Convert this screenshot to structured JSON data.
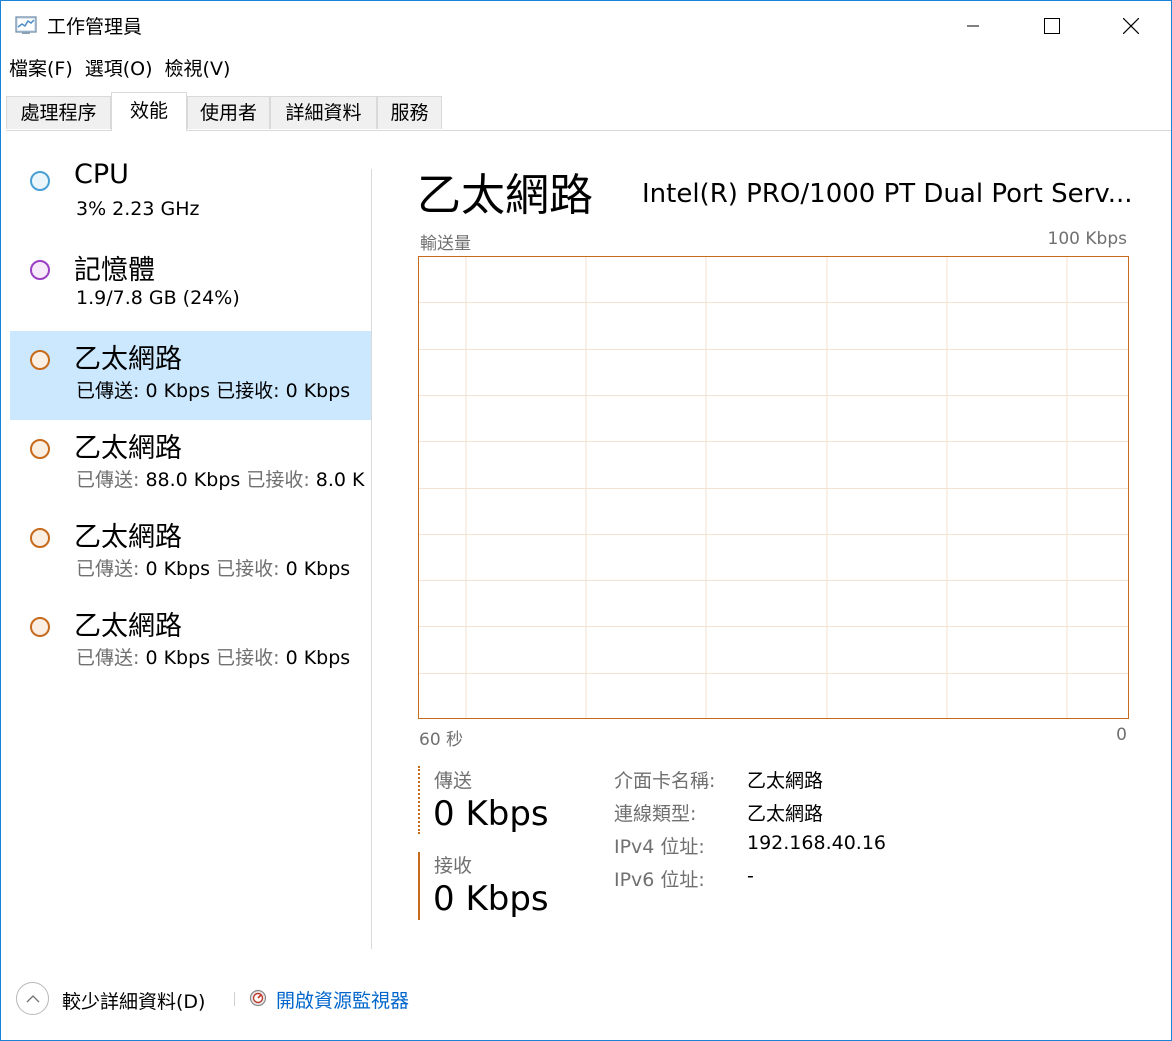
{
  "window": {
    "title": "工作管理員",
    "controls": [
      "minimize-icon",
      "maximize-icon",
      "close-icon"
    ]
  },
  "menu": {
    "items": [
      "檔案(F)",
      "選項(O)",
      "檢視(V)"
    ]
  },
  "tabs": {
    "items": [
      "處理程序",
      "效能",
      "使用者",
      "詳細資料",
      "服務"
    ],
    "active": "效能"
  },
  "sidebar": {
    "items": [
      {
        "name": "CPU",
        "detail": "3%  2.23 GHz",
        "color": "#4a9fd4",
        "selected": false
      },
      {
        "name": "記憶體",
        "detail": "1.9/7.8 GB (24%)",
        "color": "#9b3fc4",
        "selected": false
      },
      {
        "name": "乙太網路",
        "sent_label": "已傳送:",
        "sent_value": "0 Kbps",
        "recv_label": "已接收:",
        "recv_value": "0 Kbps",
        "color": "#c76a1c",
        "selected": true
      },
      {
        "name": "乙太網路",
        "sent_label": "已傳送:",
        "sent_value": "88.0 Kbps",
        "recv_label": "已接收:",
        "recv_value": "8.0 K",
        "color": "#c76a1c",
        "selected": false
      },
      {
        "name": "乙太網路",
        "sent_label": "已傳送:",
        "sent_value": "0 Kbps",
        "recv_label": "已接收:",
        "recv_value": "0 Kbps",
        "color": "#c76a1c",
        "selected": false
      },
      {
        "name": "乙太網路",
        "sent_label": "已傳送:",
        "sent_value": "0 Kbps",
        "recv_label": "已接收:",
        "recv_value": "0 Kbps",
        "color": "#c76a1c",
        "selected": false
      }
    ]
  },
  "detail": {
    "title": "乙太網路",
    "adapter": "Intel(R) PRO/1000 PT Dual Port Serv...",
    "graph": {
      "y_label": "輸送量",
      "y_max": "100 Kbps",
      "x_left": "60 秒",
      "x_right": "0",
      "border_color": "#c76a1c",
      "grid_color": "#f4e2d2"
    },
    "send": {
      "label": "傳送",
      "value": "0 Kbps"
    },
    "receive": {
      "label": "接收",
      "value": "0 Kbps"
    },
    "info": [
      {
        "key": "介面卡名稱:",
        "value": "乙太網路"
      },
      {
        "key": "連線類型:",
        "value": "乙太網路"
      },
      {
        "key": "IPv4 位址:",
        "value": "192.168.40.16"
      },
      {
        "key": "IPv6 位址:",
        "value": "-"
      }
    ]
  },
  "footer": {
    "fewer_details": "較少詳細資料(D)",
    "open_monitor": "開啟資源監視器",
    "icons": [
      "chevron-up-icon",
      "resource-monitor-icon"
    ]
  }
}
